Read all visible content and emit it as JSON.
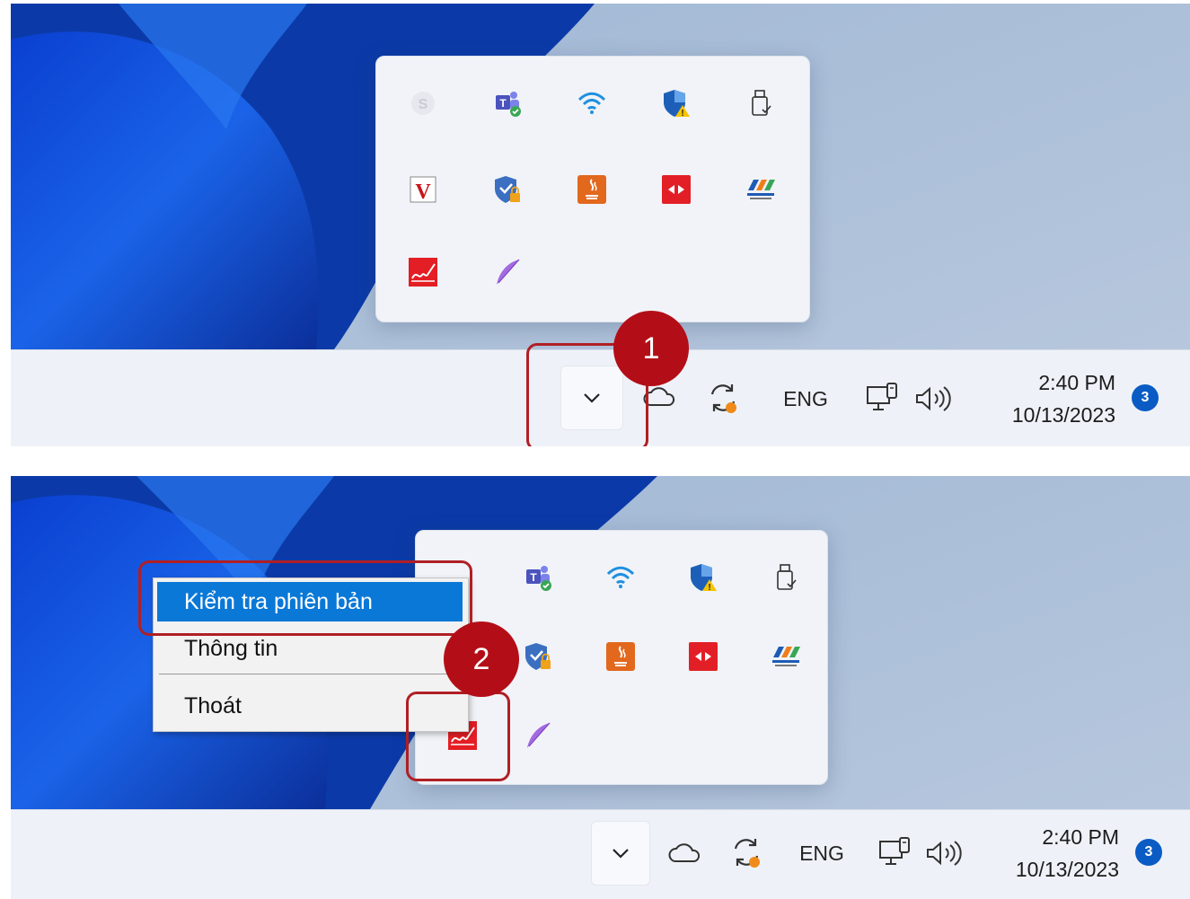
{
  "colors": {
    "accent_badge": "#b30e17",
    "callout_border": "#b01f24",
    "menu_highlight": "#0a78d7",
    "notification": "#0a5cc4"
  },
  "step_badges": [
    "1",
    "2"
  ],
  "tray_flyout": {
    "icons": [
      "skype-icon",
      "teams-icon",
      "wifi-icon",
      "security-warning-icon",
      "usb-eject-icon",
      "v-app-icon",
      "vpn-shield-icon",
      "java-icon",
      "teamviewer-icon",
      "fpt-logo-icon",
      "digital-signature-icon",
      "quill-feather-icon"
    ]
  },
  "taskbar": {
    "overflow_chevron": "chevron-down-icon",
    "language": "ENG",
    "time": "2:40 PM",
    "date": "10/13/2023",
    "notification_count": "3"
  },
  "context_menu": {
    "items": [
      {
        "label": "Kiểm tra phiên bản",
        "selected": true
      },
      {
        "label": "Thông tin",
        "selected": false
      },
      {
        "label": "Thoát",
        "selected": false
      }
    ]
  }
}
